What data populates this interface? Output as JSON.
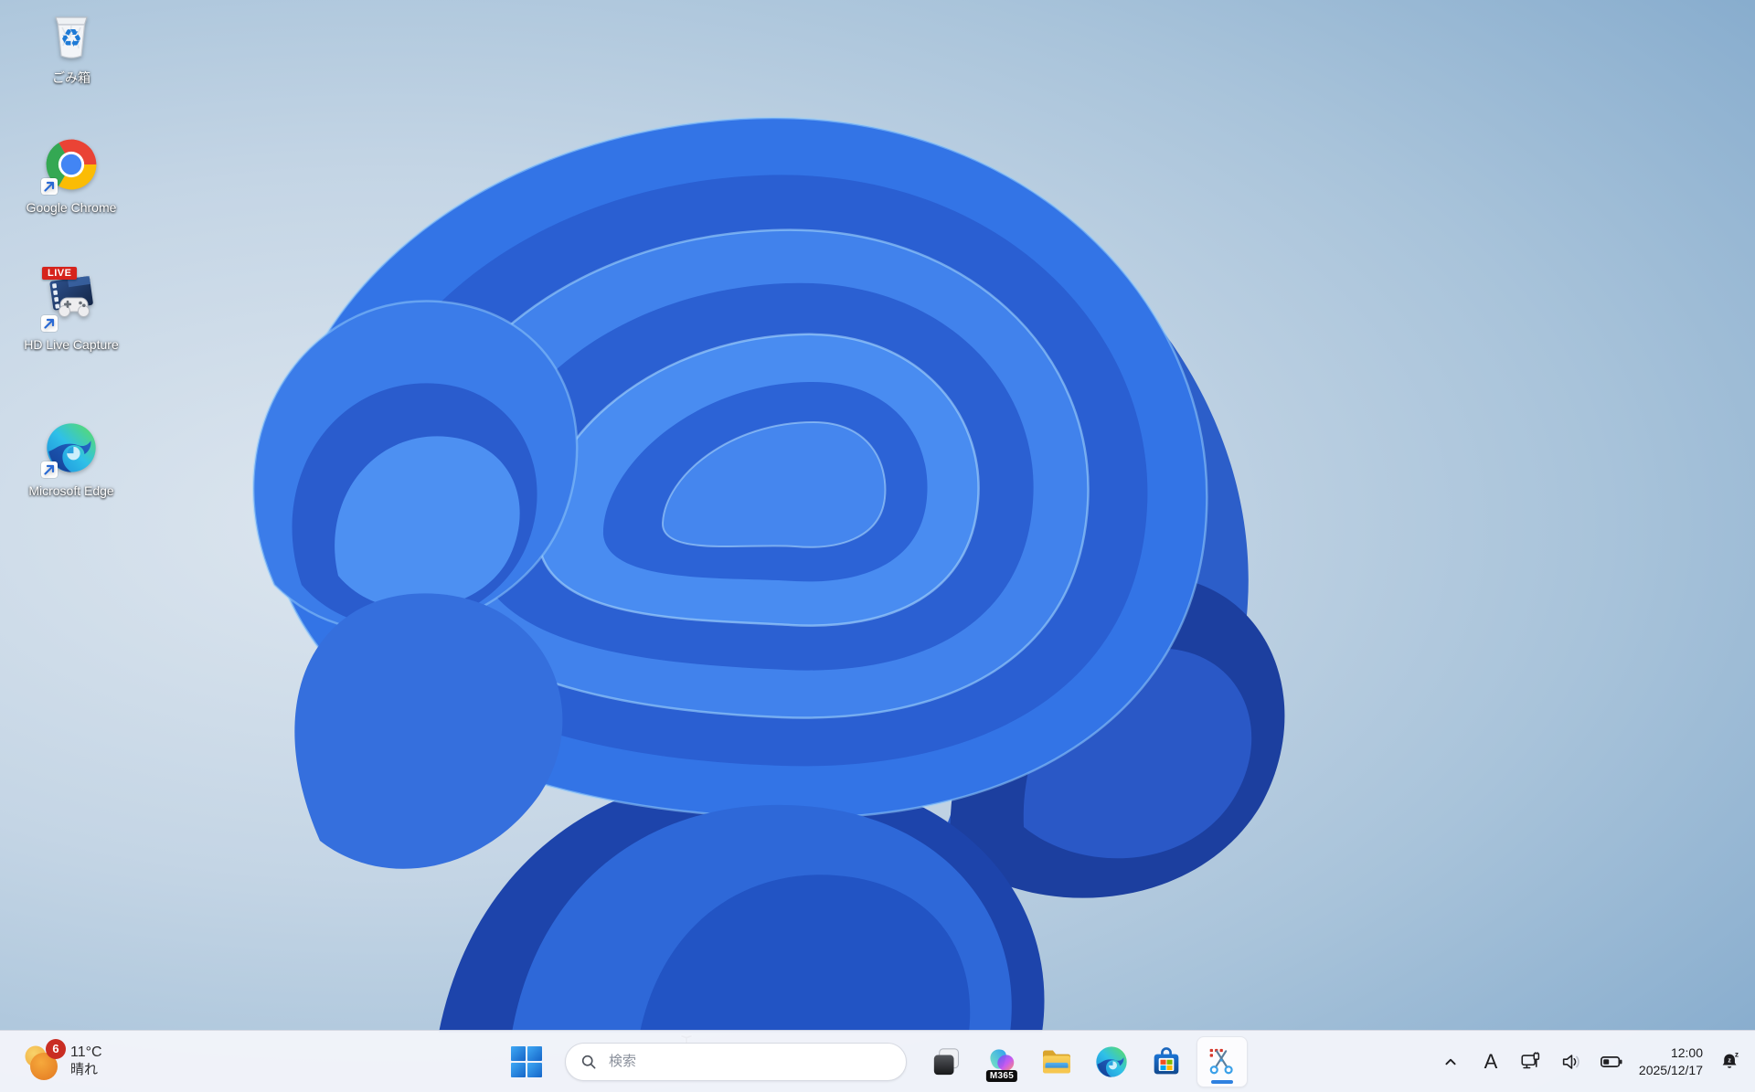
{
  "wallpaper": {
    "name": "windows-11-bloom"
  },
  "desktop": {
    "icons": [
      {
        "id": "recycle-bin",
        "label": "ごみ箱"
      },
      {
        "id": "google-chrome",
        "label": "Google Chrome"
      },
      {
        "id": "hd-live-capture",
        "label": "HD Live Capture",
        "badge": "LIVE"
      },
      {
        "id": "microsoft-edge",
        "label": "Microsoft Edge"
      }
    ]
  },
  "taskbar": {
    "weather": {
      "badge": "6",
      "temp": "11°C",
      "condition": "晴れ"
    },
    "search": {
      "placeholder": "検索"
    },
    "apps": [
      {
        "name": "task-view",
        "active": false
      },
      {
        "name": "copilot-m365",
        "badge": "M365",
        "active": false
      },
      {
        "name": "file-explorer",
        "active": false
      },
      {
        "name": "microsoft-edge",
        "active": false
      },
      {
        "name": "microsoft-store",
        "active": false
      },
      {
        "name": "snipping-tool",
        "active": true
      }
    ],
    "tray": {
      "ime": "A",
      "time": "12:00",
      "date": "2025/12/17"
    }
  },
  "colors": {
    "accent": "#2f81e0",
    "badge_red": "#c92d23",
    "taskbar_bg": "#f2f4fa",
    "bloom_dark": "#1c3f9f",
    "bloom_light": "#4a8ef1"
  }
}
